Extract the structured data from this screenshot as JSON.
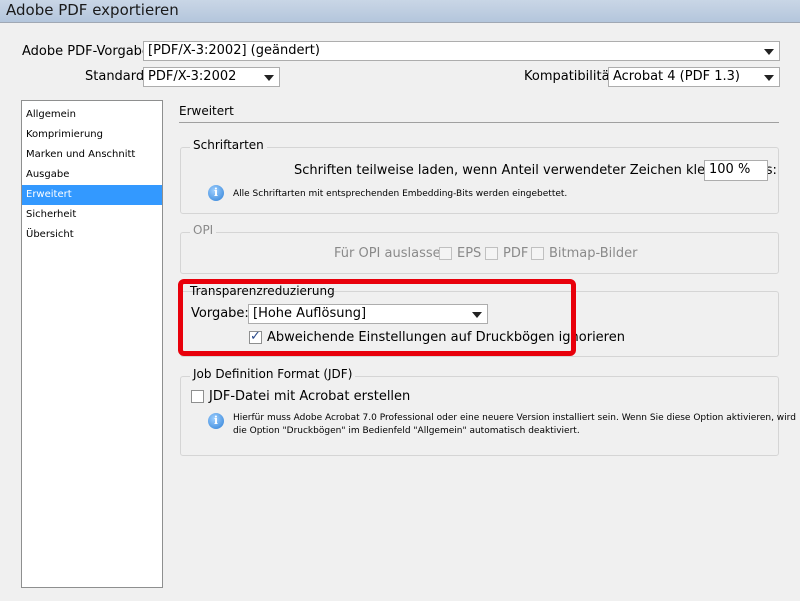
{
  "window": {
    "title": "Adobe PDF exportieren"
  },
  "top": {
    "preset_label": "Adobe PDF-Vorgabe:",
    "preset_value": "[PDF/X-3:2002] (geändert)",
    "standard_label": "Standard:",
    "standard_value": "PDF/X-3:2002",
    "compat_label": "Kompatibilität:",
    "compat_value": "Acrobat 4 (PDF 1.3)"
  },
  "sidebar": {
    "items": [
      {
        "label": "Allgemein"
      },
      {
        "label": "Komprimierung"
      },
      {
        "label": "Marken und Anschnitt"
      },
      {
        "label": "Ausgabe"
      },
      {
        "label": "Erweitert",
        "selected": true
      },
      {
        "label": "Sicherheit"
      },
      {
        "label": "Übersicht"
      }
    ]
  },
  "main": {
    "title": "Erweitert",
    "fonts": {
      "title": "Schriftarten",
      "subset_label": "Schriften teilweise laden, wenn Anteil verwendeter Zeichen kleiner ist als:",
      "subset_value": "100 %",
      "info": "Alle Schriftarten mit entsprechenden Embedding-Bits werden eingebettet."
    },
    "opi": {
      "title": "OPI",
      "omit_label": "Für OPI auslassen:",
      "eps": "EPS",
      "pdf": "PDF",
      "bitmap": "Bitmap-Bilder"
    },
    "transparency": {
      "title": "Transparenzreduzierung",
      "preset_label": "Vorgabe:",
      "preset_value": "[Hohe Auflösung]",
      "ignore_label": "Abweichende Einstellungen auf Druckbögen ignorieren",
      "ignore_checked": true
    },
    "jdf": {
      "title": "Job Definition Format (JDF)",
      "create_label": "JDF-Datei mit Acrobat erstellen",
      "create_checked": false,
      "info_line1": "Hierfür muss Adobe Acrobat 7.0 Professional oder eine neuere Version installiert sein. Wenn Sie diese Option aktivieren, wird",
      "info_line2": "die Option \"Druckbögen\" im Bedienfeld \"Allgemein\" automatisch deaktiviert."
    }
  },
  "colors": {
    "highlight": "#e8000b",
    "selection": "#3399ff"
  }
}
